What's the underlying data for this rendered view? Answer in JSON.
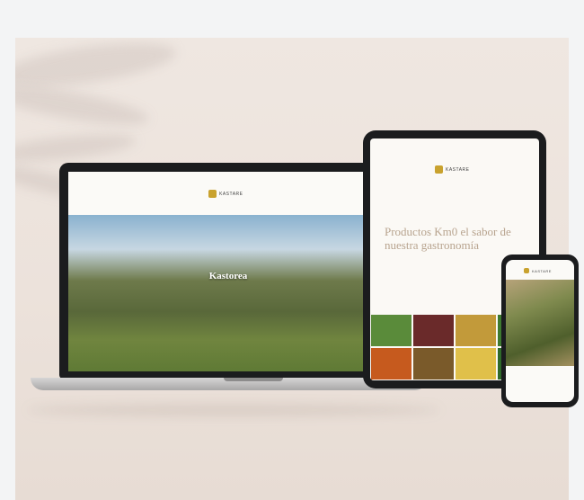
{
  "laptop": {
    "logo_text": "KASTARE",
    "hero_title": "Kastorea",
    "hero_sub": ""
  },
  "tablet": {
    "logo_text": "KASTARE",
    "heading": "Productos Km0 el sabor de nuestra gastronomía"
  },
  "phone": {
    "logo_text": "KASTARE"
  },
  "colors": {
    "background": "#ece2db",
    "device_bezel": "#1b1c1e",
    "accent_gold": "#c9a22e",
    "heading_tan": "#b8a48f"
  },
  "food_tiles": [
    "#5a8b3a",
    "#6a2a2a",
    "#c29a3a",
    "#3e7a30",
    "#c65a1e",
    "#7a5a2a",
    "#e0c04a",
    "#2f6a2a"
  ]
}
